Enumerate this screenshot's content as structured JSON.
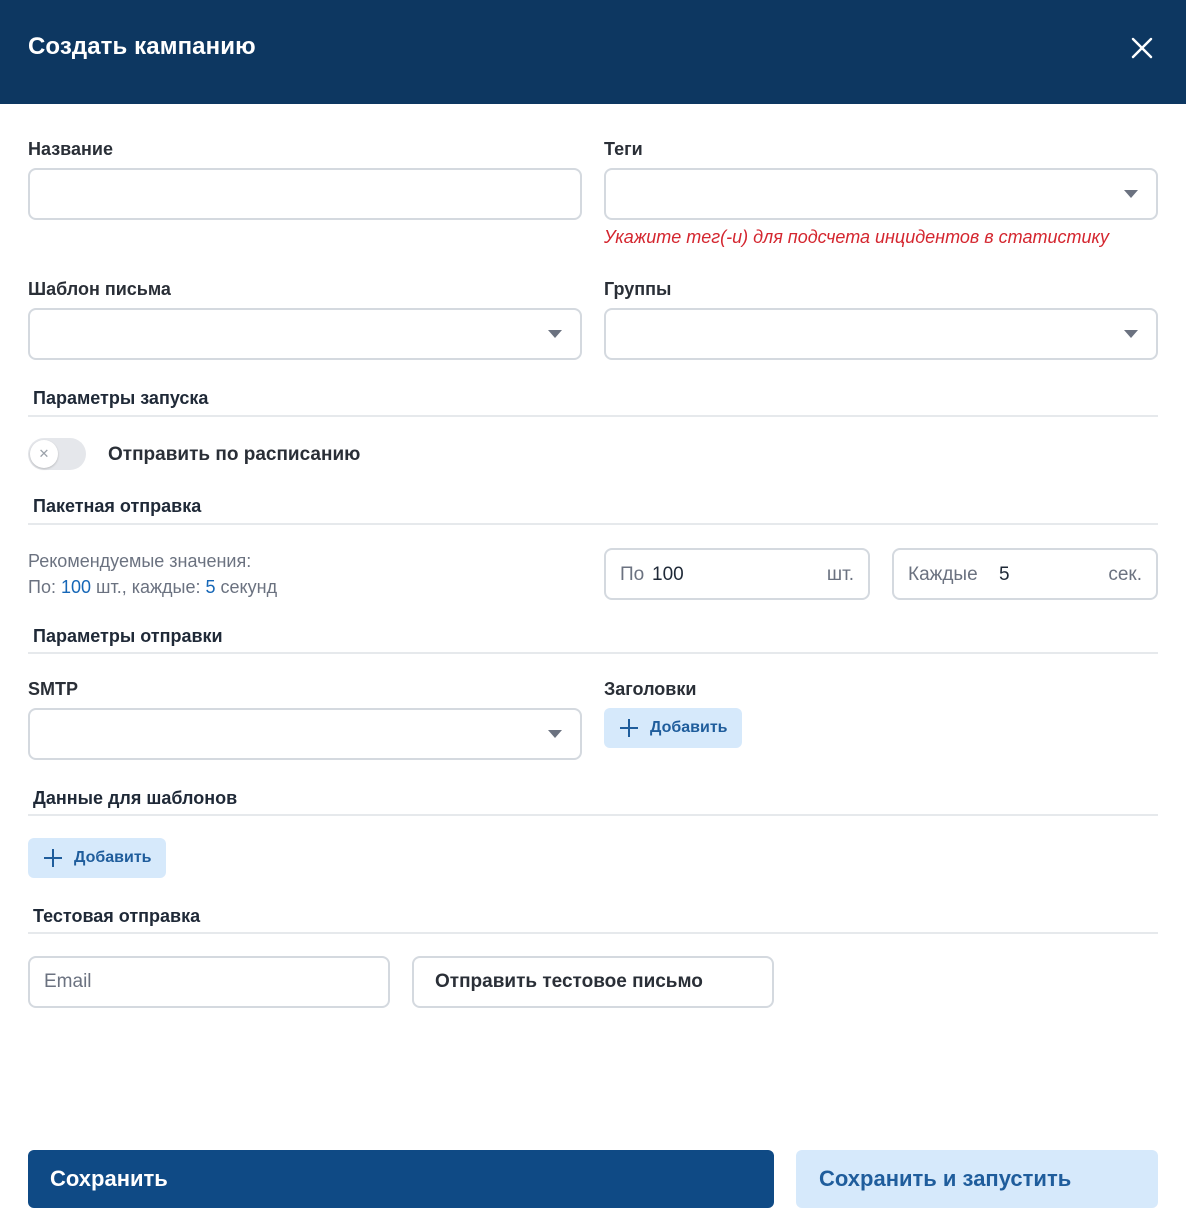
{
  "modal": {
    "title": "Создать кампанию"
  },
  "fields": {
    "name_label": "Название",
    "name_value": "",
    "tags_label": "Теги",
    "tags_value": "",
    "tags_hint": "Укажите тег(-и) для подсчета инцидентов в статистику",
    "template_label": "Шаблон письма",
    "template_value": "",
    "groups_label": "Группы",
    "groups_value": ""
  },
  "launch": {
    "section_title": "Параметры запуска",
    "schedule_label": "Отправить по расписанию",
    "schedule_enabled": false
  },
  "batch": {
    "section_title": "Пакетная отправка",
    "recommend_line1": "Рекомендуемые значения:",
    "recommend_prefix": "По:",
    "recommend_count": "100",
    "recommend_mid": "шт., каждые:",
    "recommend_seconds": "5",
    "recommend_suffix": "секунд",
    "count_prefix": "По",
    "count_value": "100",
    "count_suffix": "шт.",
    "interval_prefix": "Каждые",
    "interval_value": "5",
    "interval_suffix": "сек."
  },
  "sending": {
    "section_title": "Параметры отправки",
    "smtp_label": "SMTP",
    "smtp_value": "",
    "headers_label": "Заголовки",
    "headers_add": "Добавить"
  },
  "template_data": {
    "section_title": "Данные для шаблонов",
    "add_label": "Добавить"
  },
  "test_send": {
    "section_title": "Тестовая отправка",
    "email_placeholder": "Email",
    "send_button": "Отправить тестовое письмо"
  },
  "footer": {
    "save": "Сохранить",
    "save_and_run": "Сохранить и запустить"
  },
  "colors": {
    "header_bg": "#0d3761",
    "primary": "#0f4a85",
    "secondary_bg": "#d6e9fb",
    "link": "#1667b7",
    "error": "#d4262f"
  },
  "icons": {
    "close": "close-icon",
    "dropdown": "chevron-down-icon",
    "add": "plus-icon"
  }
}
